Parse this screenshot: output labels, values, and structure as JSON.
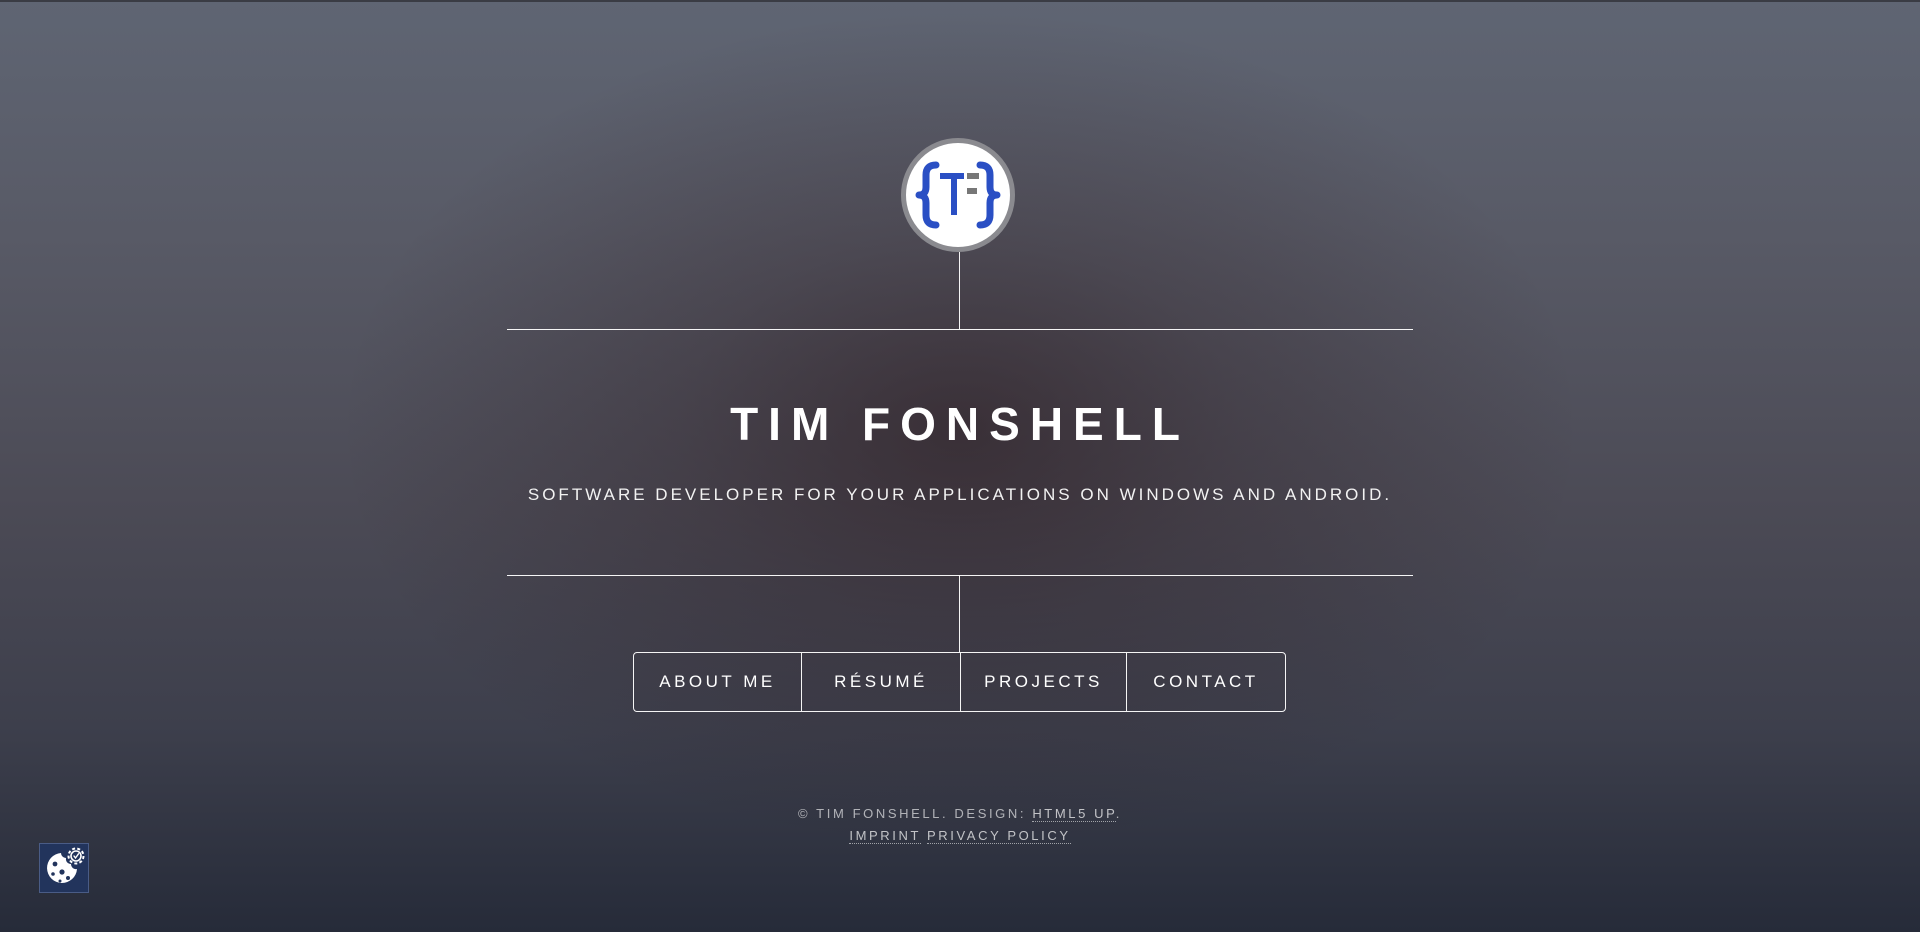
{
  "site": {
    "name": "TIM FONSHELL",
    "tagline": "SOFTWARE DEVELOPER FOR YOUR APPLICATIONS ON WINDOWS AND ANDROID.",
    "logo_icon": "curly-braces-tf-logo-icon"
  },
  "nav": {
    "items": [
      {
        "label": "ABOUT ME"
      },
      {
        "label": "RÉSUMÉ"
      },
      {
        "label": "PROJECTS"
      },
      {
        "label": "CONTACT"
      }
    ]
  },
  "footer": {
    "copyright": "© TIM FONSHELL. DESIGN: ",
    "design_link": "HTML5 UP",
    "design_suffix": ".",
    "imprint_link": "IMPRINT",
    "privacy_link": "PRIVACY POLICY"
  },
  "cookie_widget": {
    "icon": "cookie-settings-icon"
  },
  "colors": {
    "logo_blue": "#2a4fc4",
    "logo_gray": "#777777",
    "cookie_bg": "#22345c",
    "text": "#ffffff"
  }
}
